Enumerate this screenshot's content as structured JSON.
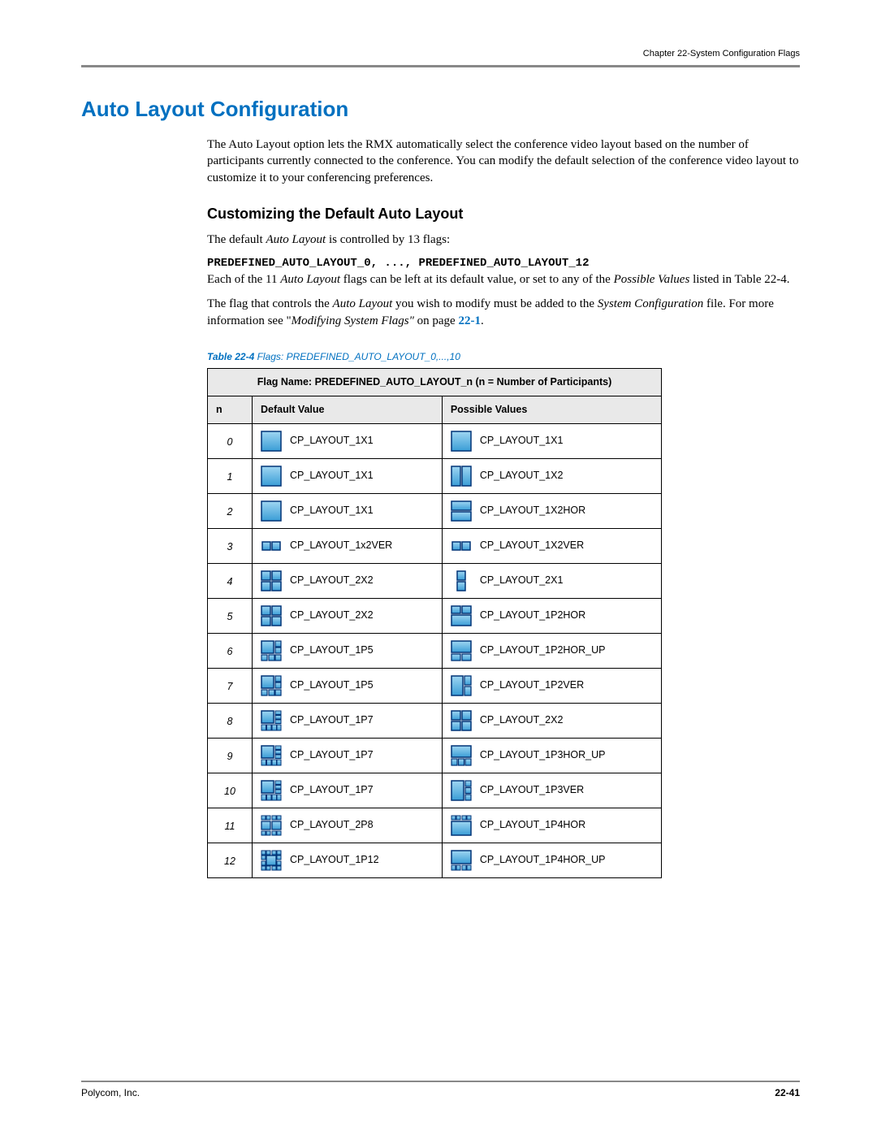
{
  "header": {
    "chapter": "Chapter 22-System Configuration Flags"
  },
  "title": "Auto Layout Configuration",
  "intro": "The Auto Layout option lets the RMX automatically select the conference video layout based on the number of participants currently connected to the conference. You can modify the default selection of the conference video layout to customize it to your conferencing preferences.",
  "subhead": "Customizing the Default Auto Layout",
  "p1_a": "The default ",
  "p1_b": "Auto Layout",
  "p1_c": " is controlled by 13 flags:",
  "flagline": "PREDEFINED_AUTO_LAYOUT_0, ..., PREDEFINED_AUTO_LAYOUT_12",
  "p2_a": "Each of the 11 ",
  "p2_b": "Auto Layout",
  "p2_c": " flags can be left at its default value, or set to any of the ",
  "p2_d": "Possible Values",
  "p2_e": " listed in Table 22-4.",
  "p3_a": "The flag that controls the ",
  "p3_b": "Auto Layout",
  "p3_c": " you wish to modify must be added to the ",
  "p3_d": "System Configuration",
  "p3_e": " file. For more information see \"",
  "p3_f": "Modifying System Flags\"",
  "p3_g": " on page ",
  "p3_link": "22-1",
  "p3_h": ".",
  "table": {
    "caption_bold": "Table 22-4",
    "caption_rest": " Flags: PREDEFINED_AUTO_LAYOUT_0,...,10",
    "title": "Flag Name: PREDEFINED_AUTO_LAYOUT_n (n = Number of Participants)",
    "col_n": "n",
    "col_default": "Default Value",
    "col_possible": "Possible Values",
    "rows": [
      {
        "n": "0",
        "dicon": "1x1",
        "dlabel": "CP_LAYOUT_1X1",
        "picon": "1x1",
        "plabel": "CP_LAYOUT_1X1"
      },
      {
        "n": "1",
        "dicon": "1x1",
        "dlabel": "CP_LAYOUT_1X1",
        "picon": "1x2v",
        "plabel": "CP_LAYOUT_1X2"
      },
      {
        "n": "2",
        "dicon": "1x1",
        "dlabel": "CP_LAYOUT_1X1",
        "picon": "1x2h",
        "plabel": "CP_LAYOUT_1X2HOR"
      },
      {
        "n": "3",
        "dicon": "1x2vsm",
        "dlabel": "CP_LAYOUT_1x2VER",
        "picon": "1x2vsm",
        "plabel": "CP_LAYOUT_1X2VER"
      },
      {
        "n": "4",
        "dicon": "2x2",
        "dlabel": "CP_LAYOUT_2X2",
        "picon": "2x1",
        "plabel": "CP_LAYOUT_2X1"
      },
      {
        "n": "5",
        "dicon": "2x2",
        "dlabel": "CP_LAYOUT_2X2",
        "picon": "1p2h",
        "plabel": "CP_LAYOUT_1P2HOR"
      },
      {
        "n": "6",
        "dicon": "1p5",
        "dlabel": "CP_LAYOUT_1P5",
        "picon": "1p2hup",
        "plabel": "CP_LAYOUT_1P2HOR_UP"
      },
      {
        "n": "7",
        "dicon": "1p5",
        "dlabel": "CP_LAYOUT_1P5",
        "picon": "1p2v",
        "plabel": "CP_LAYOUT_1P2VER"
      },
      {
        "n": "8",
        "dicon": "1p7",
        "dlabel": "CP_LAYOUT_1P7",
        "picon": "2x2",
        "plabel": "CP_LAYOUT_2X2"
      },
      {
        "n": "9",
        "dicon": "1p7",
        "dlabel": "CP_LAYOUT_1P7",
        "picon": "1p3hup",
        "plabel": "CP_LAYOUT_1P3HOR_UP"
      },
      {
        "n": "10",
        "dicon": "1p7",
        "dlabel": "CP_LAYOUT_1P7",
        "picon": "1p3v",
        "plabel": "CP_LAYOUT_1P3VER"
      },
      {
        "n": "11",
        "dicon": "2p8",
        "dlabel": "CP_LAYOUT_2P8",
        "picon": "1p4h",
        "plabel": "CP_LAYOUT_1P4HOR"
      },
      {
        "n": "12",
        "dicon": "1p12",
        "dlabel": "CP_LAYOUT_1P12",
        "picon": "1p4hup",
        "plabel": "CP_LAYOUT_1P4HOR_UP"
      }
    ]
  },
  "footer": {
    "org": "Polycom, Inc.",
    "page": "22-41"
  }
}
